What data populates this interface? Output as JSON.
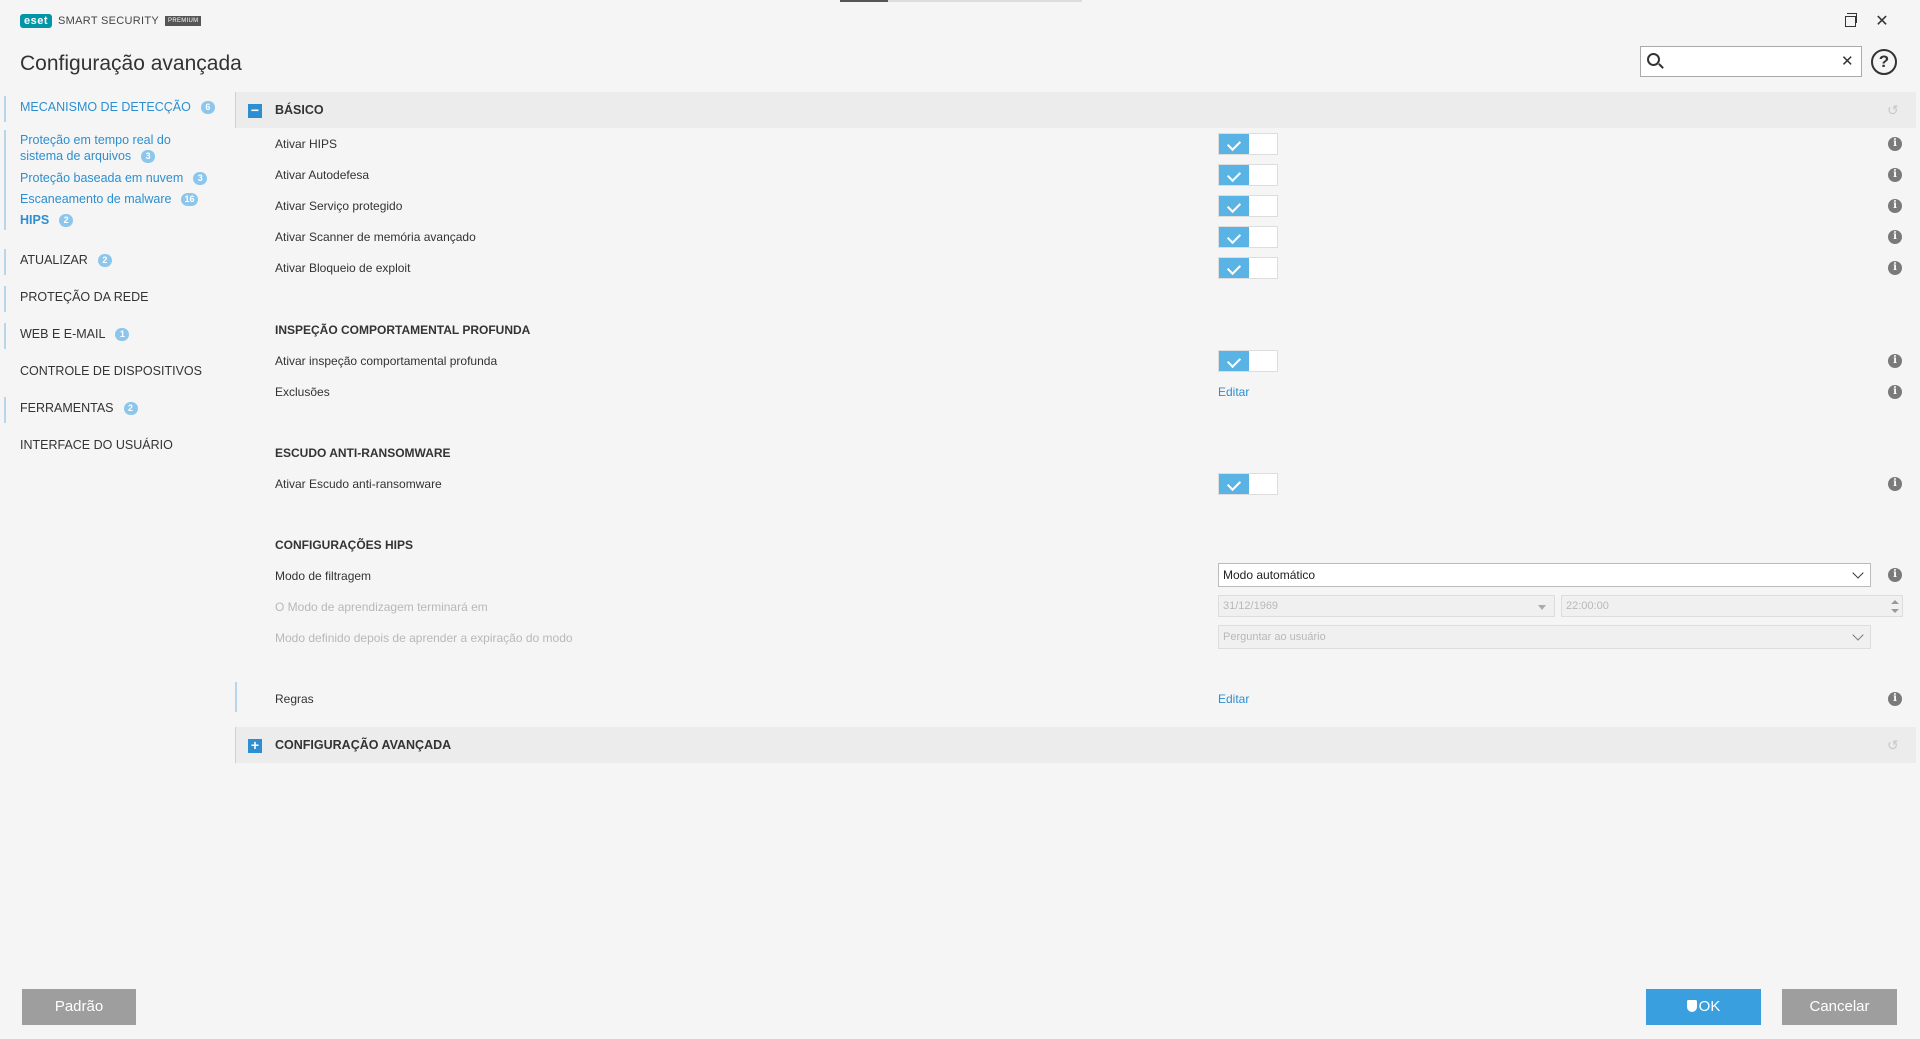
{
  "app": {
    "brand": "eset",
    "product": "SMART SECURITY",
    "edition": "PREMIUM",
    "page_title": "Configuração avançada"
  },
  "search": {
    "value": "",
    "placeholder": ""
  },
  "sidebar": {
    "items": [
      {
        "label": "MECANISMO DE DETECÇÃO",
        "badge": "6"
      },
      {
        "label": "ATUALIZAR",
        "badge": "2"
      },
      {
        "label": "PROTEÇÃO DA REDE",
        "badge": ""
      },
      {
        "label": "WEB E E-MAIL",
        "badge": "1"
      },
      {
        "label": "CONTROLE DE DISPOSITIVOS",
        "badge": ""
      },
      {
        "label": "FERRAMENTAS",
        "badge": "2"
      },
      {
        "label": "INTERFACE DO USUÁRIO",
        "badge": ""
      }
    ],
    "subitems": [
      {
        "label_line1": "Proteção em tempo real do",
        "label_line2": "sistema de arquivos",
        "badge": "3"
      },
      {
        "label": "Proteção baseada em nuvem",
        "badge": "3"
      },
      {
        "label": "Escaneamento de malware",
        "badge": "16"
      },
      {
        "label": "HIPS",
        "badge": "2"
      }
    ]
  },
  "main": {
    "basic": {
      "title": "BÁSICO",
      "rows": [
        {
          "label": "Ativar HIPS",
          "enabled": true
        },
        {
          "label": "Ativar Autodefesa",
          "enabled": true
        },
        {
          "label": "Ativar Serviço protegido",
          "enabled": true
        },
        {
          "label": "Ativar Scanner de memória avançado",
          "enabled": true
        },
        {
          "label": "Ativar Bloqueio de exploit",
          "enabled": true
        }
      ]
    },
    "deep": {
      "title": "INSPEÇÃO COMPORTAMENTAL PROFUNDA",
      "toggle_label": "Ativar inspeção comportamental profunda",
      "exclusions_label": "Exclusões",
      "exclusions_link": "Editar"
    },
    "ransom": {
      "title": "ESCUDO ANTI-RANSOMWARE",
      "toggle_label": "Ativar Escudo anti-ransomware"
    },
    "hips_config": {
      "title": "CONFIGURAÇÕES HIPS",
      "filter_mode_label": "Modo de filtragem",
      "filter_mode_value": "Modo automático",
      "learning_end_label": "O Modo de aprendizagem terminará em",
      "learning_end_date": "31/12/1969",
      "learning_end_time": "22:00:00",
      "after_mode_label": "Modo definido depois de aprender a expiração do modo",
      "after_mode_value": "Perguntar ao usuário"
    },
    "rules": {
      "label": "Regras",
      "link": "Editar"
    },
    "advanced": {
      "title": "CONFIGURAÇÃO AVANÇADA"
    }
  },
  "footer": {
    "default_label": "Padrão",
    "ok_label": "OK",
    "cancel_label": "Cancelar"
  },
  "colors": {
    "accent": "#2d8fd0",
    "toggle_on": "#5ab3e5",
    "brand": "#0096a8"
  }
}
